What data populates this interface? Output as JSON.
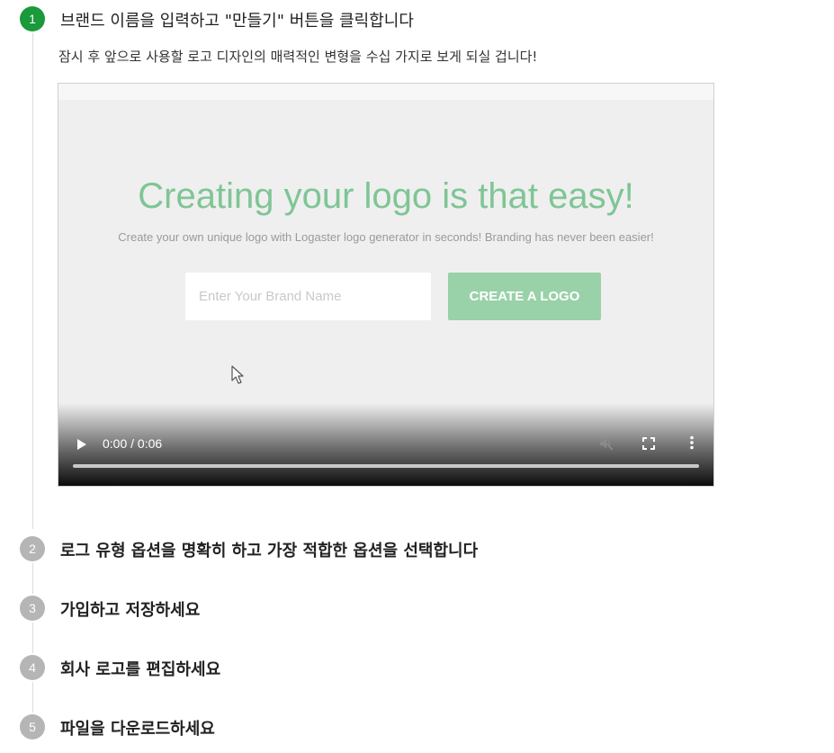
{
  "steps": [
    {
      "number": "1",
      "title": "브랜드 이름을 입력하고 \"만들기\" 버튼을 클릭합니다",
      "description": "잠시 후 앞으로 사용할 로고 디자인의 매력적인 변형을 수십 가지로 보게 되실 겁니다!",
      "active": true
    },
    {
      "number": "2",
      "title": "로그 유형 옵션을 명확히 하고 가장 적합한 옵션을 선택합니다",
      "active": false
    },
    {
      "number": "3",
      "title": "가입하고 저장하세요",
      "active": false
    },
    {
      "number": "4",
      "title": "회사 로고를 편집하세요",
      "active": false
    },
    {
      "number": "5",
      "title": "파일을 다운로드하세요",
      "active": false
    }
  ],
  "video": {
    "headline": "Creating your logo is that easy!",
    "subline": "Create your own unique logo with Logaster logo generator in seconds! Branding has never been easier!",
    "input_placeholder": "Enter Your Brand Name",
    "button_label": "CREATE A LOGO",
    "time": "0:00 / 0:06",
    "progress": 0,
    "icons": {
      "play": "play-icon",
      "mute": "muted-speaker-icon",
      "fullscreen": "fullscreen-icon",
      "more": "more-vertical-icon",
      "cursor": "mouse-pointer-icon"
    }
  },
  "colors": {
    "active_step": "#1a9a3a",
    "inactive_step": "#b5b5b5",
    "headline_green": "#7fc595",
    "button_green": "#99d1a8"
  }
}
